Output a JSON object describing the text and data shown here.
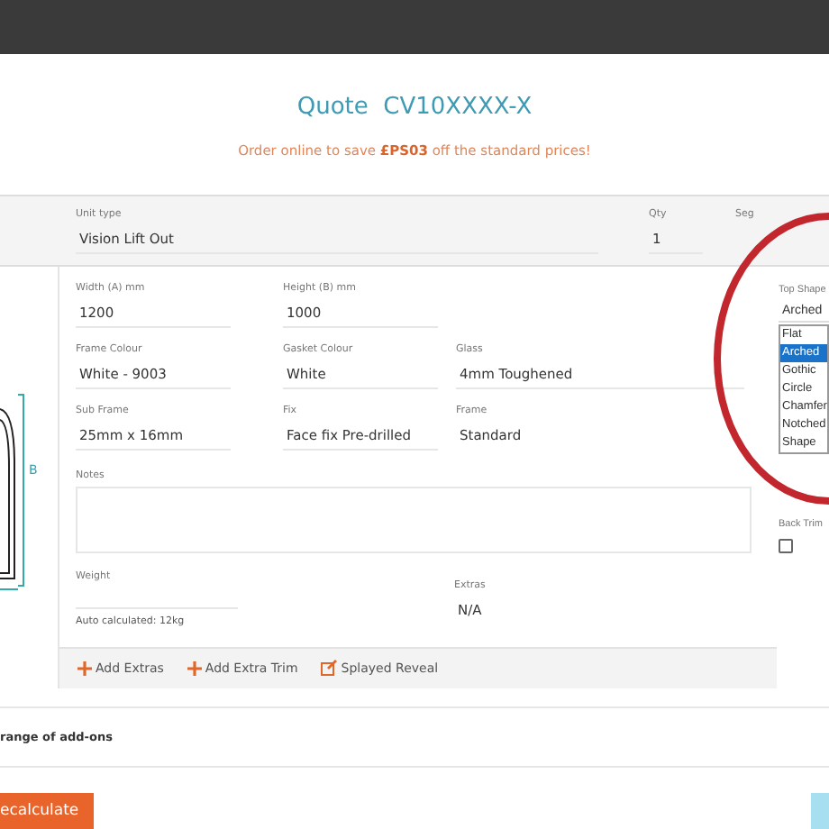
{
  "title": {
    "label": "Quote",
    "code": "CV10XXXX-X"
  },
  "promo": "Order online to save **£PS03** off the standard prices!",
  "header": {
    "unit_type": {
      "label": "Unit type",
      "value": "Vision Lift Out"
    },
    "qty": {
      "label": "Qty",
      "value": "1"
    },
    "segment": {
      "label": "Seg"
    }
  },
  "drawing": {
    "dimension": "B"
  },
  "fields": [
    {
      "label": "Width (A) mm",
      "value": "1200",
      "kind": "input"
    },
    {
      "label": "Height (B) mm",
      "value": "1000",
      "kind": "input"
    },
    {
      "kind": "empty"
    },
    {
      "label": "Frame Colour",
      "value": "White - 9003",
      "kind": "input"
    },
    {
      "label": "Gasket Colour",
      "value": "White",
      "kind": "input"
    },
    {
      "label": "Glass",
      "value": "4mm Toughened",
      "kind": "input"
    },
    {
      "label": "Sub Frame",
      "value": "25mm x 16mm",
      "kind": "input"
    },
    {
      "label": "Fix",
      "value": "Face fix Pre-drilled",
      "kind": "input"
    },
    {
      "label": "Frame",
      "value": "Standard",
      "kind": "readonly"
    }
  ],
  "notes": {
    "label": "Notes"
  },
  "weight": {
    "label": "Weight",
    "hint": "Auto calculated: 12kg"
  },
  "extras": {
    "label": "Extras",
    "value": "N/A"
  },
  "actions": [
    {
      "label": "Add Extras",
      "kind": "add"
    },
    {
      "label": "Add Extra Trim",
      "kind": "add"
    },
    {
      "label": "Splayed Reveal",
      "kind": "edit"
    }
  ],
  "top_shape": {
    "label": "Top Shape",
    "value": "Arched",
    "options": [
      {
        "label": "Flat",
        "selected": false
      },
      {
        "label": "Arched",
        "selected": true
      },
      {
        "label": "Gothic",
        "selected": false
      },
      {
        "label": "Circle",
        "selected": false
      },
      {
        "label": "Chamfer",
        "selected": false
      },
      {
        "label": "Notched",
        "selected": false
      },
      {
        "label": "Shape",
        "selected": false
      }
    ]
  },
  "back_trim": {
    "label": "Back Trim",
    "checked": false
  },
  "addons": "range of add-ons",
  "recalculate": "ecalculate"
}
